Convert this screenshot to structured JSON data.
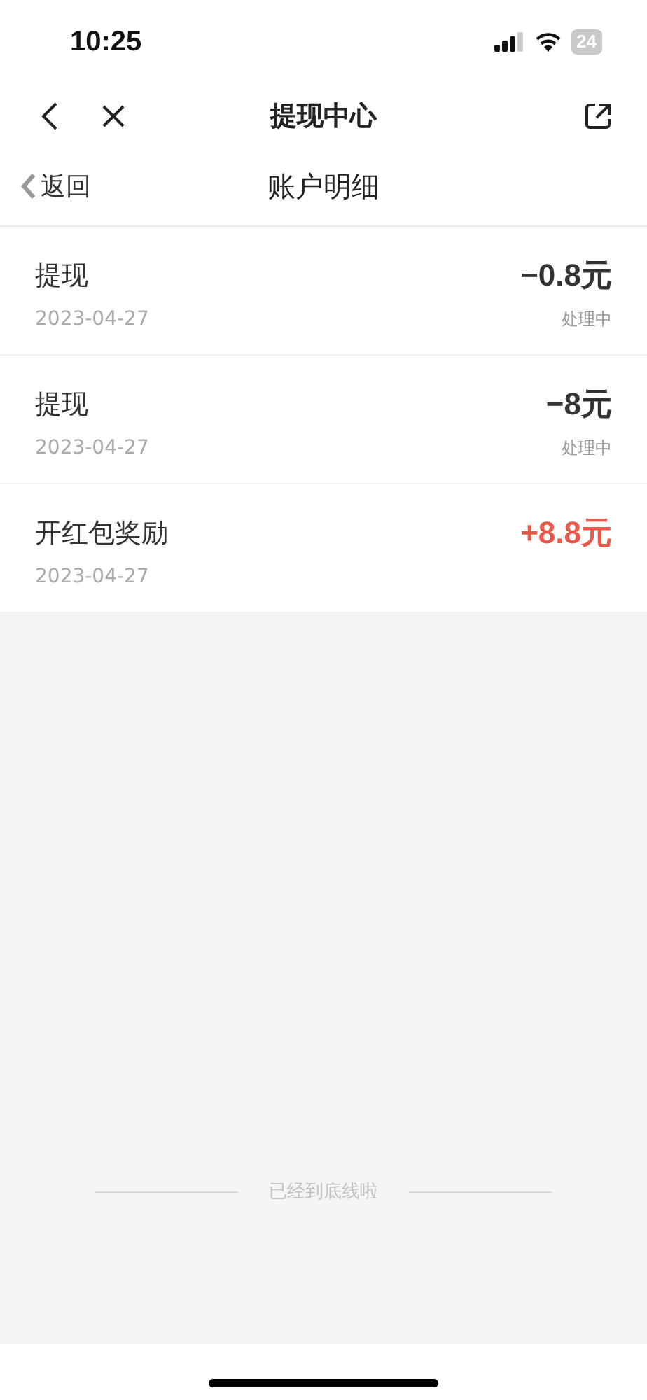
{
  "status_bar": {
    "time": "10:25",
    "battery": "24"
  },
  "nav_bar": {
    "title": "提现中心"
  },
  "sub_header": {
    "back": "返回",
    "title": "账户明细"
  },
  "records": [
    {
      "title": "提现",
      "date": "2023-04-27",
      "amount": "−0.8元",
      "color": "#333333",
      "status": "处理中"
    },
    {
      "title": "提现",
      "date": "2023-04-27",
      "amount": "−8元",
      "color": "#333333",
      "status": "处理中"
    },
    {
      "title": "开红包奖励",
      "date": "2023-04-27",
      "amount": "+8.8元",
      "color": "#e8594a"
    }
  ],
  "footer": "已经到底线啦"
}
